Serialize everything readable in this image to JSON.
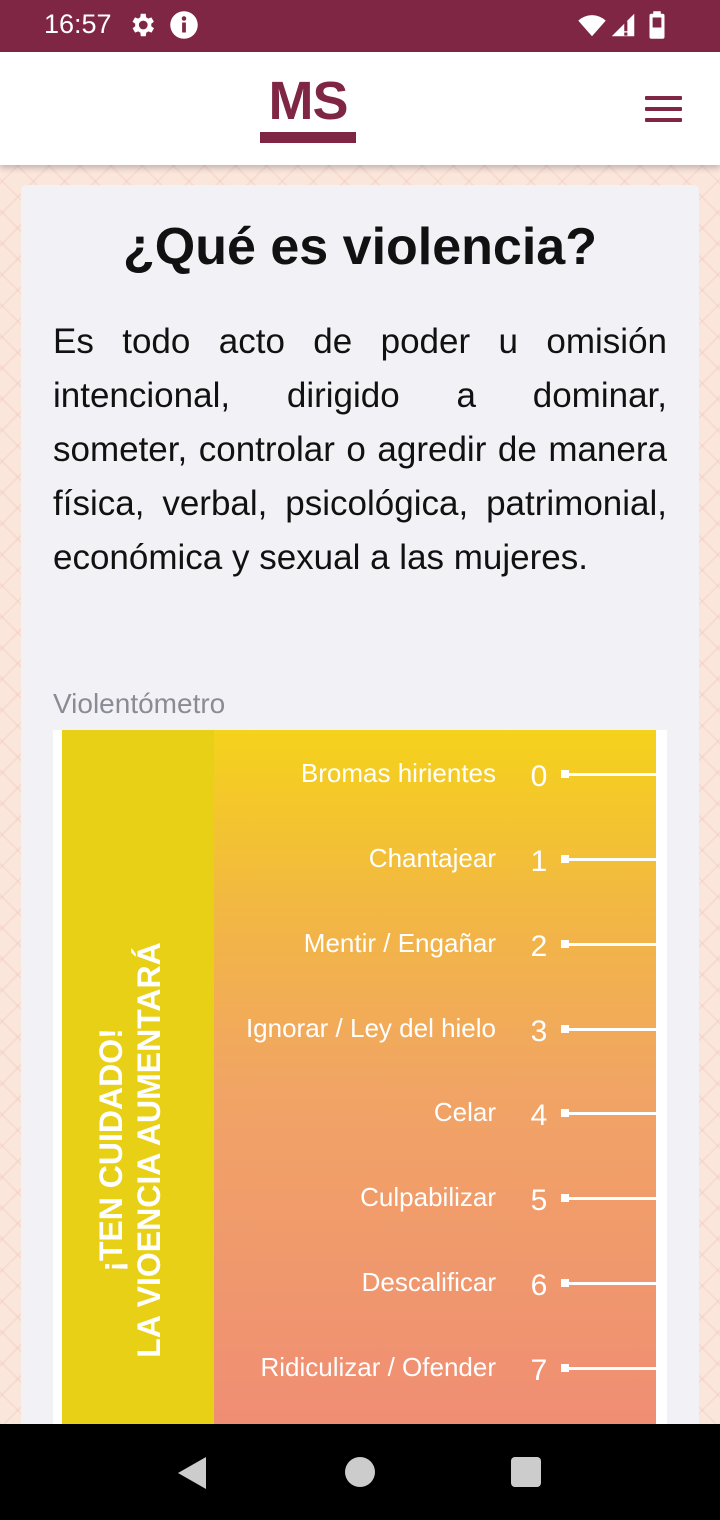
{
  "status_bar": {
    "time": "16:57",
    "icons": [
      "gear-icon",
      "info-icon",
      "wifi-icon",
      "signal-icon",
      "battery-icon"
    ],
    "background": "#7f2645"
  },
  "app_bar": {
    "logo_text": "MS",
    "menu_icon": "hamburger-menu-icon",
    "brand_color": "#7f2645"
  },
  "content": {
    "title": "¿Qué es violencia?",
    "description": "Es todo acto de poder u omisión intencional, dirigido a dominar, someter, controlar o agredir de manera física, verbal, psicológica, patrimonial, económica y sexual a las mujeres.",
    "violentometro_label": "Violentómetro",
    "warning_line1": "¡TEN CUIDADO!",
    "warning_line2": "LA VIOENCIA AUMENTARÁ",
    "levels": [
      {
        "label": "Bromas hirientes",
        "number": "0"
      },
      {
        "label": "Chantajear",
        "number": "1"
      },
      {
        "label": "Mentir / Engañar",
        "number": "2"
      },
      {
        "label": "Ignorar / Ley del hielo",
        "number": "3"
      },
      {
        "label": "Celar",
        "number": "4"
      },
      {
        "label": "Culpabilizar",
        "number": "5"
      },
      {
        "label": "Descalificar",
        "number": "6"
      },
      {
        "label": "Ridiculizar / Ofender",
        "number": "7"
      }
    ],
    "meter_colors": {
      "left": "#e8d016",
      "top": "#f5d21b",
      "bottom": "#f08c75"
    }
  },
  "nav_bar": {
    "icons": [
      "back-icon",
      "home-icon",
      "recents-icon"
    ]
  }
}
